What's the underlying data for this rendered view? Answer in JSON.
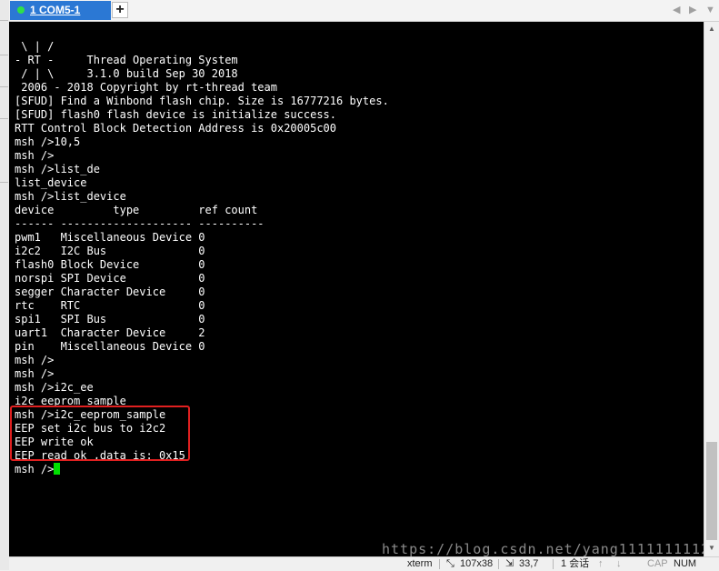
{
  "tabs": [
    {
      "number": "1",
      "label": "1 COM5-1",
      "status_color": "#2fe04a",
      "active": true
    }
  ],
  "tab_add_label": "+",
  "tab_nav": {
    "prev": "◀",
    "next": "▶",
    "menu": "▼"
  },
  "terminal": {
    "lines": [
      " \\ | /",
      "- RT -     Thread Operating System",
      " / | \\     3.1.0 build Sep 30 2018",
      " 2006 - 2018 Copyright by rt-thread team",
      "[SFUD] Find a Winbond flash chip. Size is 16777216 bytes.",
      "[SFUD] flash0 flash device is initialize success.",
      "RTT Control Block Detection Address is 0x20005c00",
      "msh />10,5",
      "msh />",
      "msh />list_de",
      "list_device",
      "msh />list_device",
      "device         type         ref count",
      "------ -------------------- ----------",
      "pwm1   Miscellaneous Device 0",
      "i2c2   I2C Bus              0",
      "flash0 Block Device         0",
      "norspi SPI Device           0",
      "segger Character Device     0",
      "rtc    RTC                  0",
      "spi1   SPI Bus              0",
      "uart1  Character Device     2",
      "pin    Miscellaneous Device 0",
      "msh />",
      "msh />",
      "msh />i2c_ee",
      "i2c eeprom sample",
      "msh />i2c_eeprom_sample",
      "EEP set i2c bus to i2c2",
      "EEP write ok",
      "EEP read ok ,data is: 0x15"
    ],
    "prompt": "msh />",
    "text_color": "#ffffff",
    "background": "#000000",
    "cursor_color": "#00e000",
    "highlight_color": "#e02020"
  },
  "watermark": "https://blog.csdn.net/yang1111111112",
  "statusbar": {
    "term_type": "xterm",
    "size": "107x38",
    "position": "33,7",
    "sessions": "1 会话",
    "caps": "CAP",
    "num": "NUM"
  },
  "accent_color": "#2b78d4"
}
